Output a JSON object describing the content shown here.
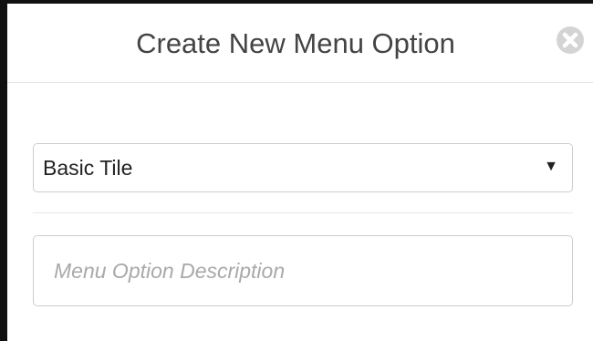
{
  "modal": {
    "title": "Create New Menu Option",
    "close_icon": "close-circle-icon"
  },
  "form": {
    "type_select": {
      "selected": "Basic Tile",
      "arrow_icon": "dropdown-triangle-icon"
    },
    "description": {
      "value": "",
      "placeholder": "Menu Option Description"
    }
  },
  "colors": {
    "title_text": "#444444",
    "border": "#cccccc",
    "placeholder_text": "#a9a9a9",
    "close_icon": "#d4d4d4"
  }
}
